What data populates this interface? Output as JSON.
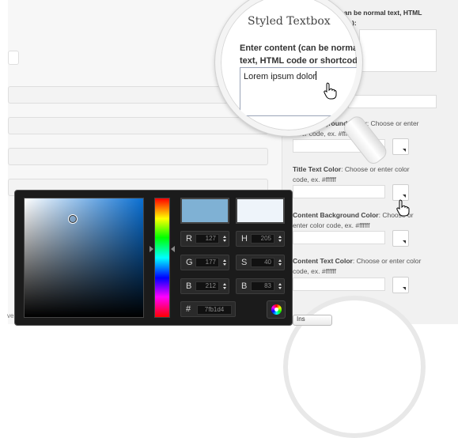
{
  "picker": {
    "r_label": "R",
    "r_value": "127",
    "g_label": "G",
    "g_value": "177",
    "b_label": "B",
    "b_value": "212",
    "h_label": "H",
    "h_value": "205",
    "s_label": "S",
    "s_value": "40",
    "v_label": "B",
    "v_value": "83",
    "hex_label": "#",
    "hex_value": "7fb1d4",
    "new_color": "#7fb1d4",
    "old_color": "#eef4fa"
  },
  "magnifier": {
    "title": "Styled Textbox",
    "label": "Enter content (can be normal text, HTML code or shortcode):",
    "value": "Lorem ipsum dolor"
  },
  "right": {
    "content_label_tail": "can be normal text, HTML",
    "content_label_tail2": "):",
    "title_bg": {
      "name": "Title Background Color",
      "hint": ": Choose or enter",
      "hint2": "color code, ex. #ffffff"
    },
    "title_text": {
      "name": "Title Text Color",
      "hint": ": Choose or enter color",
      "hint2": "code, ex. #ffffff"
    },
    "content_bg": {
      "name": "Content Background Color",
      "hint": ": Choose or",
      "hint2": "enter color code, ex. #ffffff"
    },
    "content_text": {
      "name": "Content Text Color",
      "hint": ": Choose or enter color",
      "hint2": "code, ex. #ffffff"
    },
    "insert_label": "Ins"
  },
  "left": {
    "footer_fragment": "ve"
  }
}
